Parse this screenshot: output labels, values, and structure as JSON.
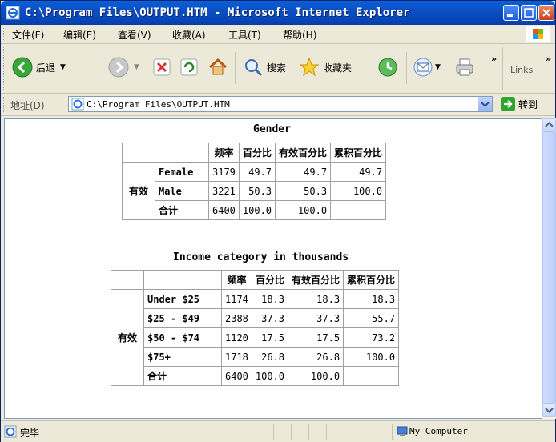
{
  "window": {
    "title": "C:\\Program Files\\OUTPUT.HTM - Microsoft Internet Explorer"
  },
  "menu": [
    "文件(F)",
    "编辑(E)",
    "查看(V)",
    "收藏(A)",
    "工具(T)",
    "帮助(H)"
  ],
  "toolbar": {
    "back_label": "后退",
    "search_label": "搜索",
    "favorites_label": "收藏夹",
    "more_chevron": "»",
    "links_label": "Links"
  },
  "address": {
    "label": "地址(D)",
    "value": "C:\\Program Files\\OUTPUT.HTM",
    "go_label": "转到"
  },
  "gender_table": {
    "caption": "Gender",
    "headers": [
      "频率",
      "百分比",
      "有效百分比",
      "累积百分比"
    ],
    "group_label": "有效",
    "rows": [
      {
        "label": "Female",
        "cells": [
          "3179",
          "49.7",
          "49.7",
          "49.7"
        ]
      },
      {
        "label": "Male",
        "cells": [
          "3221",
          "50.3",
          "50.3",
          "100.0"
        ]
      },
      {
        "label": "合计",
        "cells": [
          "6400",
          "100.0",
          "100.0",
          ""
        ]
      }
    ]
  },
  "income_table": {
    "caption": "Income category in thousands",
    "headers": [
      "频率",
      "百分比",
      "有效百分比",
      "累积百分比"
    ],
    "group_label": "有效",
    "rows": [
      {
        "label": "Under $25",
        "cells": [
          "1174",
          "18.3",
          "18.3",
          "18.3"
        ]
      },
      {
        "label": "$25 - $49",
        "cells": [
          "2388",
          "37.3",
          "37.3",
          "55.7"
        ]
      },
      {
        "label": "$50 - $74",
        "cells": [
          "1120",
          "17.5",
          "17.5",
          "73.2"
        ]
      },
      {
        "label": "$75+",
        "cells": [
          "1718",
          "26.8",
          "26.8",
          "100.0"
        ]
      },
      {
        "label": "合计",
        "cells": [
          "6400",
          "100.0",
          "100.0",
          ""
        ]
      }
    ]
  },
  "status": {
    "text": "完毕",
    "zone": "My Computer"
  }
}
